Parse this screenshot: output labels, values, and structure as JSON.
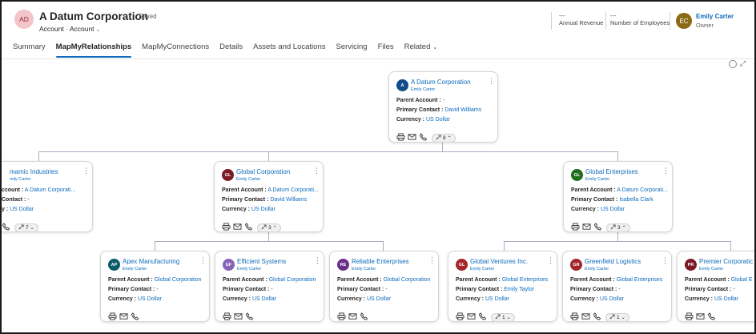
{
  "header": {
    "avatar_initials": "AD",
    "title": "A Datum Corporation",
    "saved": "- Saved",
    "entity": "Account",
    "form": "Account",
    "annual_revenue_value": "---",
    "annual_revenue_label": "Annual Revenue",
    "employees_value": "---",
    "employees_label": "Number of Employees",
    "owner_initials": "EC",
    "owner_name": "Emily Carter",
    "owner_role": "Owner"
  },
  "tabs": [
    "Summary",
    "MapMyRelationships",
    "MapMyConnections",
    "Details",
    "Assets and Locations",
    "Servicing",
    "Files",
    "Related"
  ],
  "active_tab": "MapMyRelationships",
  "labels": {
    "parent": "Parent Account :",
    "contact": "Primary Contact :",
    "currency": "Currency :"
  },
  "cards": {
    "root": {
      "initials": "A",
      "color": "#0f4c8a",
      "name": "A Datum Corporation",
      "owner": "Emily Carter",
      "parent": "-",
      "contact": "David Williams",
      "currency": "US Dollar",
      "count": "8"
    },
    "dyn": {
      "initials": "",
      "color": "#0f4c8a",
      "name": "mamic Industries",
      "owner": "mily Carter",
      "parent": "A Datum Corporati...",
      "contact": "-",
      "currency": "US Dollar",
      "count": "7",
      "parent_label": "ccount :",
      "contact_label": "Contact :",
      "currency_label": "y :"
    },
    "gc": {
      "initials": "GL",
      "color": "#7a1b25",
      "name": "Global Corporation",
      "owner": "Emily Carter",
      "parent": "A Datum Corporati...",
      "contact": "David Williams",
      "currency": "US Dollar",
      "count": "3"
    },
    "ge": {
      "initials": "GL",
      "color": "#1e6e1e",
      "name": "Global Enterprises",
      "owner": "Emily Carter",
      "parent": "A Datum Corporati...",
      "contact": "Isabella Clark",
      "currency": "US Dollar",
      "count": "3"
    },
    "apex": {
      "initials": "AP",
      "color": "#0b5c6b",
      "name": "Apex Manufacturing",
      "owner": "Emily Carter",
      "parent": "Global Corporation",
      "contact": "-",
      "currency": "US Dollar"
    },
    "eff": {
      "initials": "EF",
      "color": "#8764b8",
      "name": "Efficient Systems",
      "owner": "Emily Carter",
      "parent": "Global Corporation",
      "contact": "-",
      "currency": "US Dollar"
    },
    "rel": {
      "initials": "RE",
      "color": "#6b2e8a",
      "name": "Reliable Enterprises",
      "owner": "Emily Carter",
      "parent": "Global Corporation",
      "contact": "-",
      "currency": "US Dollar"
    },
    "gv": {
      "initials": "GL",
      "color": "#a4262c",
      "name": "Global Ventures Inc.",
      "owner": "Emily Carter",
      "parent": "Global Enterprises",
      "contact": "Emily Taylor",
      "currency": "US Dollar",
      "count": "1"
    },
    "gl": {
      "initials": "GR",
      "color": "#a4262c",
      "name": "Greenfield Logistics",
      "owner": "Emily Carter",
      "parent": "Global Enterprises",
      "contact": "-",
      "currency": "US Dollar",
      "count": "1"
    },
    "pc": {
      "initials": "PR",
      "color": "#7a1b25",
      "name": "Premier Corporatic",
      "owner": "Emily Carter",
      "parent": "Global E",
      "contact": "-",
      "currency": "US Dollar"
    }
  }
}
